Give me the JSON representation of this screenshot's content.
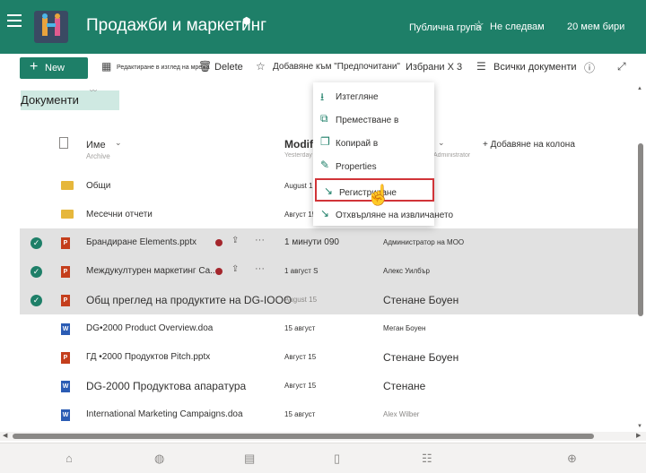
{
  "header": {
    "site_title": "Продажби и маркетинг",
    "group_type": "Публична група",
    "follow": "Не следвам",
    "members": "20 мем бири"
  },
  "toolbar": {
    "new": "New",
    "edit_grid": "Редактиране в изглед на мрежа",
    "delete": "Delete",
    "add_favorites": "Добавяне към \"Предпочитани\"",
    "favorites": "Избрани Х 3",
    "all_documents": "Всички документи"
  },
  "library": {
    "title": "Документи"
  },
  "columns": {
    "name": "Име",
    "modified": "Modifi",
    "add_column": "+ Добавяне на колона"
  },
  "ghost_row": {
    "name": "Archive",
    "modified": "Yesterday",
    "modified_by": "Administrator"
  },
  "rows": [
    {
      "type": "folder",
      "name": "Общи",
      "modified": "August 15",
      "modified_by": ""
    },
    {
      "type": "folder",
      "name": "Месечни отчети",
      "modified": "Август 15",
      "modified_by": ""
    },
    {
      "type": "ppt",
      "name": "Брандиране Elements.pptx",
      "modified": "1 минути 090",
      "modified_by": "Администратор на МОО",
      "selected": true
    },
    {
      "type": "ppt",
      "name": "Междукултурен маркетинг Ca...",
      "modified": "1 август S",
      "modified_by": "Алекс Уилбър",
      "selected": true
    },
    {
      "type": "ppt",
      "name": "Общ преглед на продуктите на DG-IOOO",
      "modified": "August 15",
      "modified_by": "Стенане Боуен",
      "selected": true
    },
    {
      "type": "word",
      "name": "DG•2000 Product Overview.doa",
      "modified": "15 август",
      "modified_by": "Меган Боуен"
    },
    {
      "type": "ppt",
      "name": "ГД •2000 Продуктов Pitch.pptx",
      "modified": "Август 15",
      "modified_by": "Стенане Боуен"
    },
    {
      "type": "word",
      "name": "DG-2000 Продуктова апаратура",
      "modified": "Август 15",
      "modified_by": "Стенане"
    },
    {
      "type": "word",
      "name": "International Marketing Campaigns.doa",
      "modified": "15 август",
      "modified_by": "Alex Wilber"
    }
  ],
  "context_menu": {
    "items": [
      {
        "label": "Изтегляне",
        "icon": "download-icon"
      },
      {
        "label": "Преместване в",
        "icon": "move-icon"
      },
      {
        "label": "Копирай в",
        "icon": "copy-icon"
      },
      {
        "label": "Properties",
        "icon": "pencil-icon"
      },
      {
        "label": "Регистриране",
        "icon": "checkin-icon"
      },
      {
        "label": "Отхвърляне на извличането",
        "icon": "discard-checkout-icon"
      }
    ],
    "highlighted_index": 4
  },
  "accent_color": "#1e7f68"
}
